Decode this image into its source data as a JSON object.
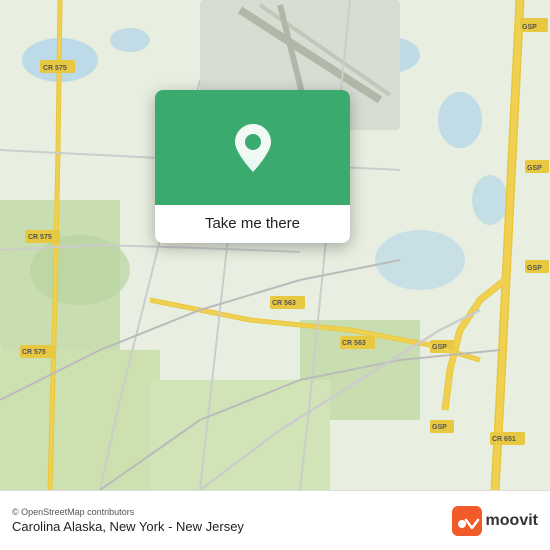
{
  "map": {
    "background_color": "#e8f0e0"
  },
  "popup": {
    "green_color": "#3aaa6e",
    "button_label": "Take me there"
  },
  "bottom_bar": {
    "attribution": "© OpenStreetMap contributors",
    "location_name": "Carolina Alaska, New York - New Jersey",
    "moovit_text": "moovit"
  },
  "map_labels": {
    "cr575_top": "CR 575",
    "cr575_mid": "CR 575",
    "cr575_bottom": "CR 575",
    "cr563_mid": "CR 563",
    "cr563_lower": "CR 563",
    "cr651": "CR 651",
    "gsp_top": "GSP",
    "gsp_right1": "GSP",
    "gsp_right2": "GSP",
    "gsp_bottom1": "GSP",
    "gsp_bottom2": "GSP"
  }
}
